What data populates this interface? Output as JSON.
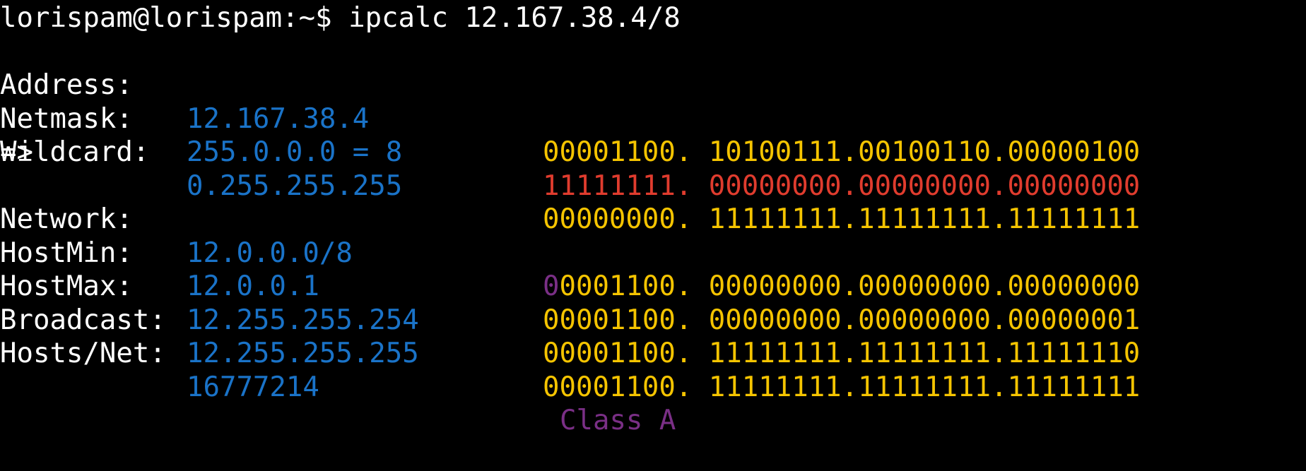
{
  "terminal": {
    "prompt": "lorispam@lorispam:~$ ",
    "command": "ipcalc 12.167.38.4/8",
    "arrow": "=>",
    "colors": {
      "background": "#000000",
      "label": "#ffffff",
      "value": "#1a73c8",
      "binary": "#f5c400",
      "netmask_binary": "#e03c2e",
      "class_bits": "#7a2f86"
    },
    "rows": {
      "address": {
        "label": "Address:",
        "value": "12.167.38.4",
        "bin_first": "00001100.",
        "bin_rest": " 10100111.00100110.00000100"
      },
      "netmask": {
        "label": "Netmask:",
        "value": "255.0.0.0 = 8",
        "bin_first": "11111111.",
        "bin_rest": " 00000000.00000000.00000000"
      },
      "wildcard": {
        "label": "Wildcard:",
        "value": "0.255.255.255",
        "bin_first": "00000000.",
        "bin_rest": " 11111111.11111111.11111111"
      },
      "network": {
        "label": "Network:",
        "value": "12.0.0.0/8",
        "class_bit": "0",
        "bin_first": "0001100.",
        "bin_rest": " 00000000.00000000.00000000"
      },
      "hostmin": {
        "label": "HostMin:",
        "value": "12.0.0.1",
        "bin_first": "00001100.",
        "bin_rest": " 00000000.00000000.00000001"
      },
      "hostmax": {
        "label": "HostMax:",
        "value": "12.255.255.254",
        "bin_first": "00001100.",
        "bin_rest": " 11111111.11111111.11111110"
      },
      "broadcast": {
        "label": "Broadcast:",
        "value": "12.255.255.255",
        "bin_first": "00001100.",
        "bin_rest": " 11111111.11111111.11111111"
      },
      "hosts": {
        "label": "Hosts/Net:",
        "value": "16777214",
        "class_label": "Class A"
      }
    }
  }
}
